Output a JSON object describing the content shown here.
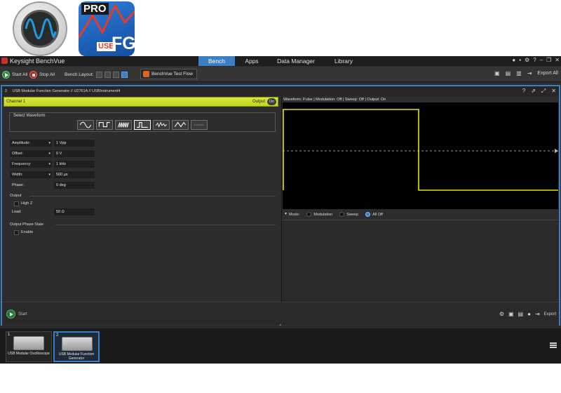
{
  "app": {
    "title": "Keysight BenchVue"
  },
  "tabs": [
    {
      "label": "Bench",
      "active": true
    },
    {
      "label": "Apps",
      "active": false
    },
    {
      "label": "Data Manager",
      "active": false
    },
    {
      "label": "Library",
      "active": false
    }
  ],
  "toolbar": {
    "start_all": "Start All",
    "stop_all": "Stop All",
    "bench_layout": "Bench Layout:",
    "test_flow": "BenchVue Test Flow",
    "export_all": "Export All"
  },
  "panel": {
    "number": "2",
    "title": "USB Modular Function Generator // U2761A // USBInstrument4",
    "help_icon": "?"
  },
  "channel": {
    "label": "Channel 1",
    "output_label": "Output",
    "output_state": "On",
    "color": "#d4e42c"
  },
  "waveform": {
    "group_label": "Select Waveform",
    "options": [
      "sine",
      "square",
      "ramp",
      "pulse",
      "noise-like",
      "triangle",
      "dc"
    ],
    "selected": "pulse"
  },
  "params": [
    {
      "label": "Amplitude:",
      "value": "1 Vpp",
      "dropdown": true
    },
    {
      "label": "Offset:",
      "value": "0 V",
      "dropdown": true
    },
    {
      "label": "Frequency:",
      "value": "1 kHz",
      "dropdown": true
    },
    {
      "label": "Width:",
      "value": "500 µs",
      "dropdown": true
    },
    {
      "label": "Phase:",
      "value": "0 deg",
      "dropdown": false
    }
  ],
  "output": {
    "section_label": "Output",
    "highz_label": "High Z",
    "load_label": "Load:",
    "load_value": "50 Ω"
  },
  "phase_state": {
    "section_label": "Output Phase State",
    "enable_label": "Enable"
  },
  "preview": {
    "info": "Waveform: Pulse | Modulation: Off | Sweep: Off | Output: On",
    "mode_label": "Mode:",
    "modes": [
      {
        "label": "Modulation",
        "selected": false
      },
      {
        "label": "Sweep",
        "selected": false
      },
      {
        "label": "All Off",
        "selected": true
      }
    ],
    "trace_color": "#e6e600"
  },
  "footer": {
    "start": "Start",
    "export": "Export"
  },
  "instruments": [
    {
      "number": "1",
      "label": "USB Modular Oscilloscope",
      "selected": false
    },
    {
      "number": "2",
      "label": "USB Modular Function Generator",
      "selected": true
    }
  ],
  "logos": {
    "fg_badge_top": "PRO",
    "fg_badge_usb": "USB",
    "fg_badge_main": "FG"
  }
}
